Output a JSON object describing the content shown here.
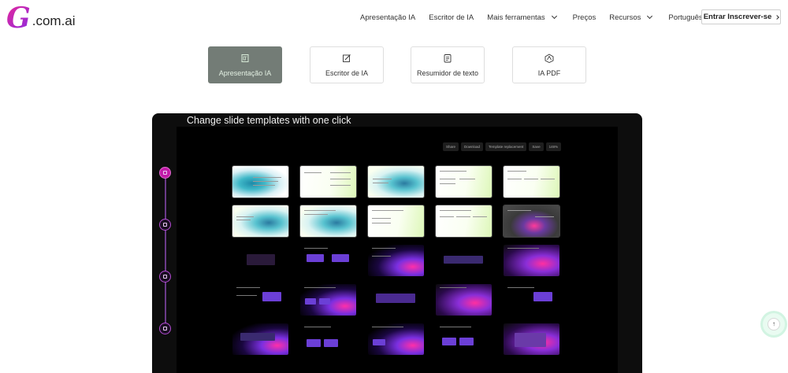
{
  "logo": {
    "letter": "G",
    "domain": ".com.ai"
  },
  "nav": {
    "items": [
      {
        "label": "Apresentação IA",
        "dropdown": false
      },
      {
        "label": "Escritor de IA",
        "dropdown": false
      },
      {
        "label": "Mais ferramentas",
        "dropdown": true
      },
      {
        "label": "Preços",
        "dropdown": false
      },
      {
        "label": "Recursos",
        "dropdown": true
      },
      {
        "label": "Português",
        "dropdown": true
      }
    ],
    "login_label": "Entrar Inscrever-se"
  },
  "tools": [
    {
      "label": "Apresentação IA",
      "icon": "presentation-icon",
      "active": true
    },
    {
      "label": "Escritor de IA",
      "icon": "pen-edit-icon",
      "active": false
    },
    {
      "label": "Resumidor de texto",
      "icon": "document-summary-icon",
      "active": false
    },
    {
      "label": "IA PDF",
      "icon": "pdf-icon",
      "active": false
    }
  ],
  "demo": {
    "title": "Change slide templates with one click",
    "toolbar": [
      "Share",
      "Download",
      "Template replacement",
      "Save",
      "146%"
    ]
  },
  "colors": {
    "accent": "#c21ba8",
    "active_tab": "#737c76",
    "demo_bg": "#0d0d0d"
  }
}
